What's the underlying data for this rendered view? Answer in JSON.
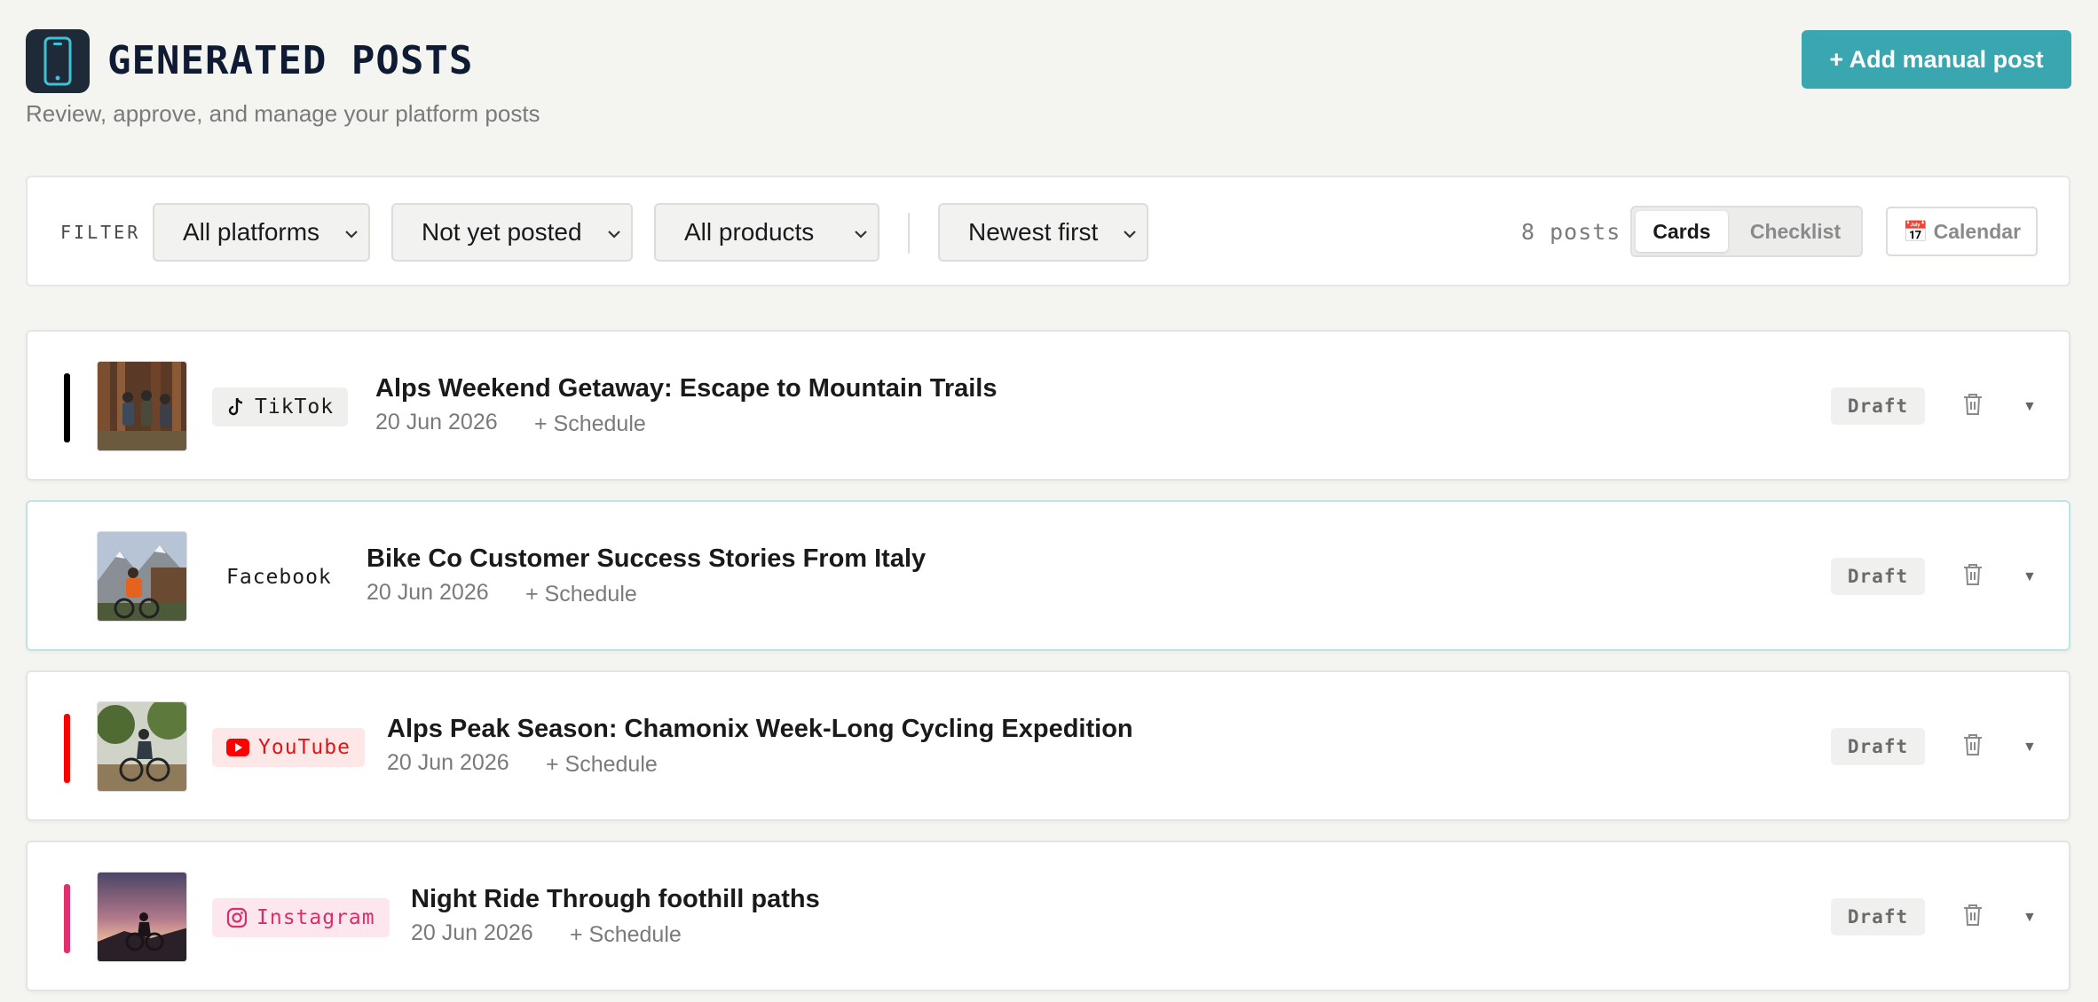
{
  "header": {
    "title": "GENERATED POSTS",
    "subtitle": "Review, approve, and manage your platform posts",
    "add_button": "+ Add manual post",
    "app_icon": "phone-icon"
  },
  "filters": {
    "label": "FILTER",
    "platform": "All platforms",
    "status": "Not yet posted",
    "product": "All products",
    "sort": "Newest first",
    "count": "8 posts",
    "view_cards": "Cards",
    "view_checklist": "Checklist",
    "view_active": "Cards",
    "calendar": "Calendar",
    "calendar_icon": "📅"
  },
  "posts": [
    {
      "platform": "TikTok",
      "platform_icon": "tiktok-icon",
      "accent": "#000000",
      "badge_bg": "#efefed",
      "badge_color": "#1a1a1a",
      "title": "Alps Weekend Getaway: Escape to Mountain Trails",
      "date": "20 Jun 2026",
      "schedule": "+ Schedule",
      "status": "Draft"
    },
    {
      "platform": "Facebook",
      "platform_icon": "",
      "accent": "",
      "badge_bg": "#ffffff",
      "badge_color": "#1a1a1a",
      "title": "Bike Co Customer Success Stories From Italy",
      "date": "20 Jun 2026",
      "schedule": "+ Schedule",
      "status": "Draft"
    },
    {
      "platform": "YouTube",
      "platform_icon": "youtube-icon",
      "accent": "#ff0000",
      "badge_bg": "#fde7e7",
      "badge_color": "#e01616",
      "title": "Alps Peak Season: Chamonix Week-Long Cycling Expedition",
      "date": "20 Jun 2026",
      "schedule": "+ Schedule",
      "status": "Draft"
    },
    {
      "platform": "Instagram",
      "platform_icon": "instagram-icon",
      "accent": "#e1306c",
      "badge_bg": "#fde6ee",
      "badge_color": "#d62f6a",
      "title": "Night Ride Through foothill paths",
      "date": "20 Jun 2026",
      "schedule": "+ Schedule",
      "status": "Draft"
    }
  ]
}
